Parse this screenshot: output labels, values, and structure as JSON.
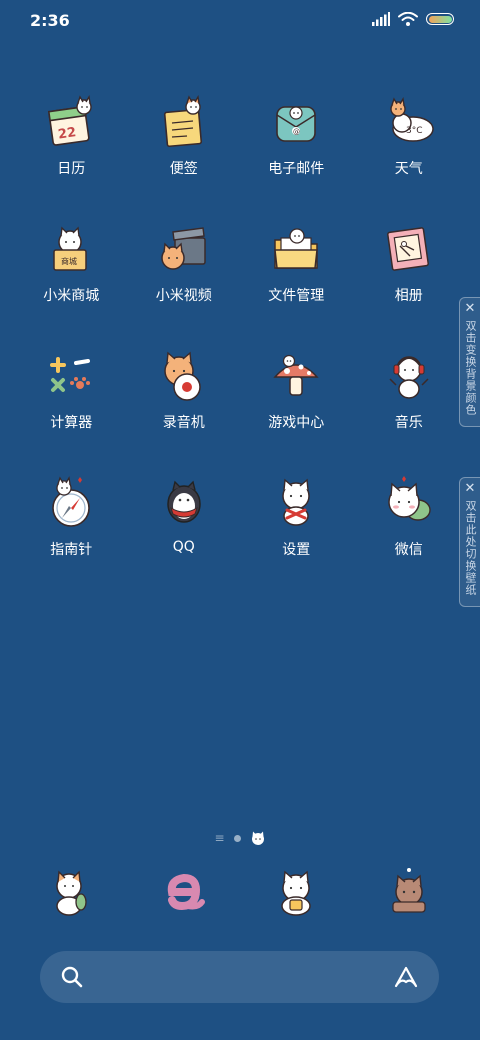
{
  "status_bar": {
    "time": "2:36"
  },
  "apps": [
    {
      "label": "日历",
      "icon": "calendar-icon"
    },
    {
      "label": "便签",
      "icon": "notes-icon"
    },
    {
      "label": "电子邮件",
      "icon": "email-icon"
    },
    {
      "label": "天气",
      "icon": "weather-icon",
      "icon_text": "3°C"
    },
    {
      "label": "小米商城",
      "icon": "mi-store-icon"
    },
    {
      "label": "小米视频",
      "icon": "mi-video-icon"
    },
    {
      "label": "文件管理",
      "icon": "file-manager-icon"
    },
    {
      "label": "相册",
      "icon": "gallery-icon"
    },
    {
      "label": "计算器",
      "icon": "calculator-icon"
    },
    {
      "label": "录音机",
      "icon": "recorder-icon"
    },
    {
      "label": "游戏中心",
      "icon": "game-center-icon"
    },
    {
      "label": "音乐",
      "icon": "music-icon"
    },
    {
      "label": "指南针",
      "icon": "compass-icon"
    },
    {
      "label": "QQ",
      "icon": "qq-icon"
    },
    {
      "label": "设置",
      "icon": "settings-icon"
    },
    {
      "label": "微信",
      "icon": "wechat-icon"
    }
  ],
  "side_tabs": {
    "change_bg": "双击变换背景颜色",
    "change_wallpaper": "双击此处切换壁纸",
    "close_glyph": "✕"
  },
  "page_indicator": {
    "lines_glyph": "≡"
  },
  "dock": [
    {
      "icon": "phone-icon"
    },
    {
      "icon": "browser-icon"
    },
    {
      "icon": "messages-icon"
    },
    {
      "icon": "camera-icon"
    }
  ],
  "colors": {
    "background": "#1e5083",
    "text": "#ffffff"
  }
}
